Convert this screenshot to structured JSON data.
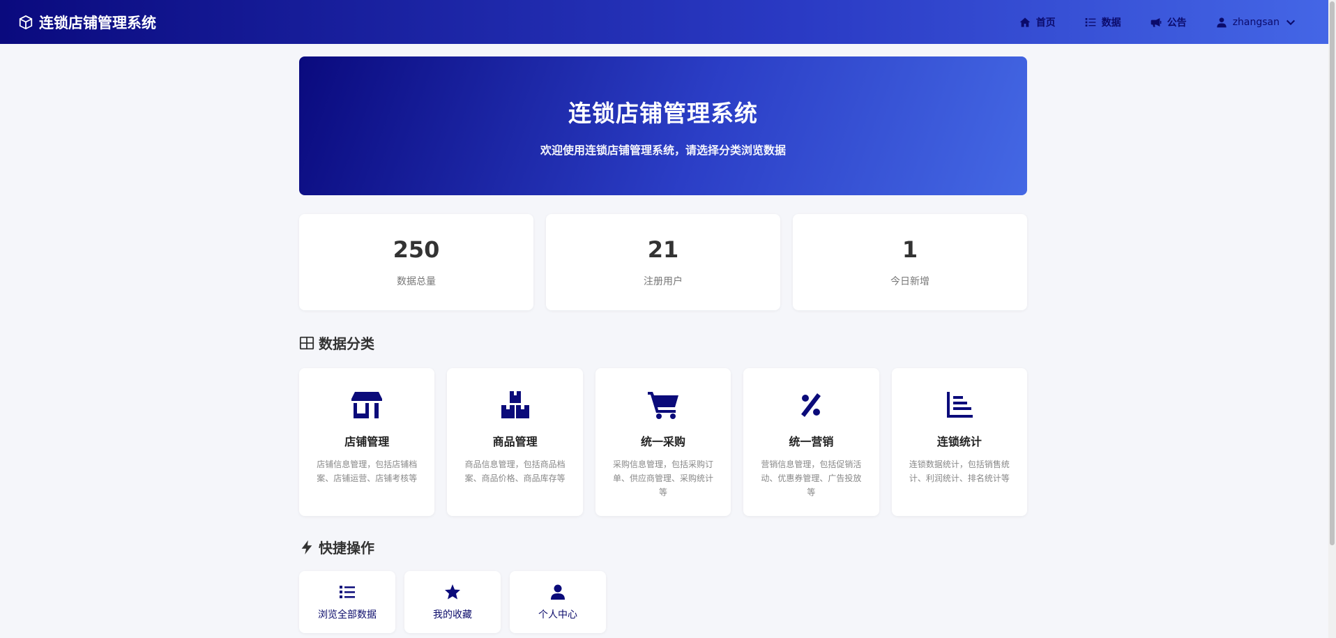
{
  "nav": {
    "brand": "连锁店铺管理系统",
    "items": [
      {
        "label": "首页",
        "icon": "home-icon"
      },
      {
        "label": "数据",
        "icon": "list-icon"
      },
      {
        "label": "公告",
        "icon": "megaphone-icon"
      }
    ],
    "user": "zhangsan"
  },
  "hero": {
    "title": "连锁店铺管理系统",
    "subtitle": "欢迎使用连锁店铺管理系统，请选择分类浏览数据"
  },
  "stats": [
    {
      "value": "250",
      "label": "数据总量"
    },
    {
      "value": "21",
      "label": "注册用户"
    },
    {
      "value": "1",
      "label": "今日新增"
    }
  ],
  "categories_title": "数据分类",
  "categories": [
    {
      "title": "店铺管理",
      "desc": "店铺信息管理，包括店铺档案、店铺运营、店铺考核等",
      "icon": "store-icon"
    },
    {
      "title": "商品管理",
      "desc": "商品信息管理，包括商品档案、商品价格、商品库存等",
      "icon": "boxes-icon"
    },
    {
      "title": "统一采购",
      "desc": "采购信息管理，包括采购订单、供应商管理、采购统计等",
      "icon": "cart-icon"
    },
    {
      "title": "统一营销",
      "desc": "营销信息管理，包括促销活动、优惠券管理、广告投放等",
      "icon": "percent-icon"
    },
    {
      "title": "连锁统计",
      "desc": "连锁数据统计，包括销售统计、利润统计、排名统计等",
      "icon": "chart-icon"
    }
  ],
  "quick_title": "快捷操作",
  "quick": [
    {
      "label": "浏览全部数据",
      "icon": "list-icon"
    },
    {
      "label": "我的收藏",
      "icon": "star-icon"
    },
    {
      "label": "个人中心",
      "icon": "user-icon"
    }
  ],
  "colors": {
    "primary": "#0b0b7a",
    "accent": "#4468e4",
    "background": "#f5f6fa"
  }
}
